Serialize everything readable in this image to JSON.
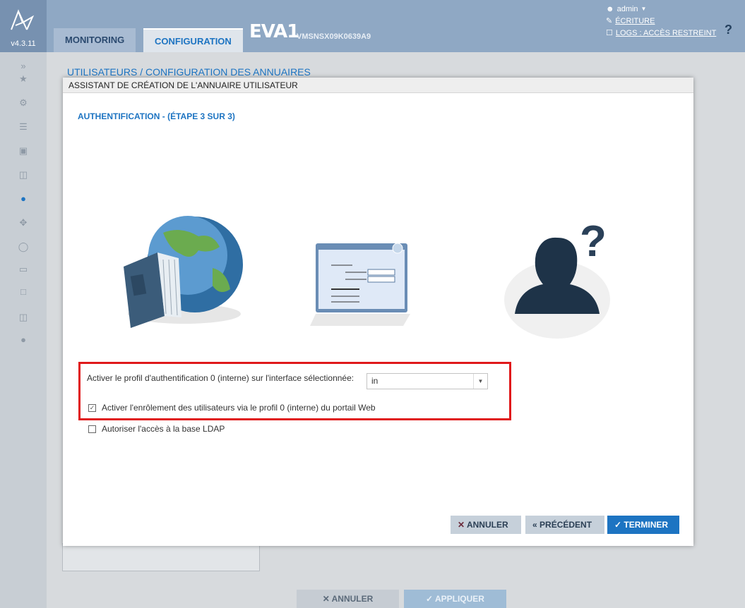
{
  "header": {
    "version": "v4.3.11",
    "tabs": [
      {
        "label": "MONITORING"
      },
      {
        "label": "CONFIGURATION"
      }
    ],
    "brand": "EVA1",
    "serial": "VMSNSX09K0639A9",
    "user": "admin",
    "write_link": "ÉCRITURE",
    "logs_link": "LOGS : ACCÈS RESTREINT",
    "help": "?"
  },
  "breadcrumb": "UTILISATEURS / CONFIGURATION DES ANNUAIRES",
  "modal": {
    "title": "ASSISTANT DE CRÉATION DE L'ANNUAIRE UTILISATEUR",
    "step_title": "AUTHENTIFICATION - (ÉTAPE 3 SUR 3)",
    "profile_label": "Activer le profil d'authentification 0 (interne) sur l'interface sélectionnée:",
    "interface_value": "in",
    "enrollment_label": "Activer l'enrôlement des utilisateurs via le profil 0 (interne) du portail Web",
    "enrollment_checked": true,
    "ldap_label": "Autoriser l'accès à la base LDAP",
    "ldap_checked": false,
    "buttons": {
      "cancel": "ANNULER",
      "previous": "PRÉCÉDENT",
      "finish": "TERMINER"
    }
  },
  "footer_buttons": {
    "cancel": "ANNULER",
    "apply": "APPLIQUER"
  },
  "colors": {
    "accent": "#1d74c2",
    "highlight": "#e0191b",
    "header": "#8fa8c4"
  }
}
